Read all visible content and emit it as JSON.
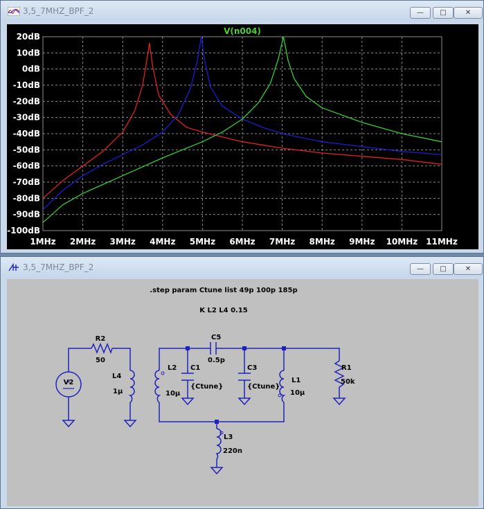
{
  "plot_window": {
    "title": "3,5_7MHZ_BPF_2",
    "trace_label": "V(n004)",
    "x_ticks": [
      "1MHz",
      "2MHz",
      "3MHz",
      "4MHz",
      "5MHz",
      "6MHz",
      "7MHz",
      "8MHz",
      "9MHz",
      "10MHz",
      "11MHz"
    ],
    "y_ticks": [
      "20dB",
      "10dB",
      "0dB",
      "-10dB",
      "-20dB",
      "-30dB",
      "-40dB",
      "-50dB",
      "-60dB",
      "-70dB",
      "-80dB",
      "-90dB",
      "-100dB"
    ],
    "colors": {
      "background": "#000000",
      "grid": "#8c8c8c",
      "axis_text": "#ffffff",
      "trace_label": "#4ccf3a",
      "step1": "#e02222",
      "step2": "#1c1cd0",
      "step3": "#35d035"
    }
  },
  "chart_data": {
    "type": "line",
    "title": "V(n004)",
    "x_unit": "MHz",
    "y_unit": "dB",
    "xlim": [
      1,
      11
    ],
    "ylim": [
      -100,
      20
    ],
    "grid": true,
    "series": [
      {
        "color": "red",
        "x": [
          1,
          1.5,
          2,
          2.5,
          3,
          3.3,
          3.5,
          3.6,
          3.67,
          3.75,
          3.9,
          4.2,
          4.6,
          5,
          5.5,
          6,
          6.5,
          7,
          8,
          9,
          10,
          11
        ],
        "y": [
          -80,
          -69,
          -60,
          -51,
          -39,
          -26,
          -10,
          5,
          16,
          2,
          -16,
          -28,
          -36,
          -39,
          -42,
          -45,
          -47,
          -49,
          -52,
          -54,
          -56,
          -59
        ]
      },
      {
        "color": "blue",
        "x": [
          1,
          1.5,
          2,
          2.5,
          3,
          3.5,
          4,
          4.4,
          4.7,
          4.87,
          4.97,
          5.05,
          5.2,
          5.5,
          6,
          6.5,
          7,
          8,
          9,
          10,
          11
        ],
        "y": [
          -87,
          -75,
          -66,
          -59,
          -53,
          -47,
          -39,
          -28,
          -12,
          5,
          20,
          6,
          -11,
          -23,
          -31,
          -36,
          -40,
          -45,
          -48,
          -51,
          -53
        ]
      },
      {
        "color": "green",
        "x": [
          1,
          1.5,
          2,
          3,
          4,
          5,
          5.5,
          6,
          6.4,
          6.7,
          6.9,
          7.03,
          7.15,
          7.3,
          7.6,
          8,
          9,
          10,
          11
        ],
        "y": [
          -95,
          -84,
          -77,
          -66,
          -55,
          -45,
          -39,
          -31,
          -21,
          -9,
          6,
          20,
          5,
          -6,
          -17,
          -24,
          -33,
          -40,
          -45
        ]
      }
    ]
  },
  "schematic_window": {
    "title": "3,5_7MHZ_BPF_2",
    "directive_step": ".step param Ctune list 49p 100p 185p",
    "directive_k": "K L2 L4  0.15",
    "components": {
      "V2": {
        "name": "V2"
      },
      "R2": {
        "name": "R2",
        "value": "50"
      },
      "L4": {
        "name": "L4",
        "value": "1µ"
      },
      "L2": {
        "name": "L2",
        "value": "10µ"
      },
      "C1": {
        "name": "C1",
        "value": "{Ctune}"
      },
      "C5": {
        "name": "C5",
        "value": "0.5p"
      },
      "C3": {
        "name": "C3",
        "value": "{Ctune}"
      },
      "L1": {
        "name": "L1",
        "value": "10µ"
      },
      "R1": {
        "name": "R1",
        "value": "50k"
      },
      "L3": {
        "name": "L3",
        "value": "220n"
      }
    },
    "colors": {
      "background": "#c0c0c0",
      "wire": "#1f22b8",
      "node": "#1f22b8",
      "text": "#000000"
    }
  },
  "window_controls": {
    "minimize": "—",
    "maximize": "□",
    "close": "✕"
  }
}
